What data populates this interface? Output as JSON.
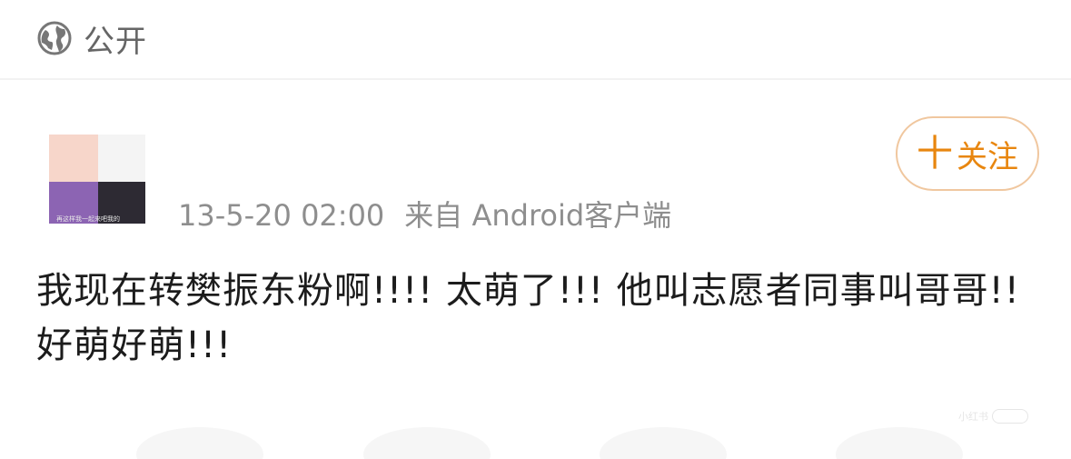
{
  "visibility": {
    "icon": "globe-icon",
    "label": "公开"
  },
  "post": {
    "avatar": {
      "caption": "再这样我一起来吧我的"
    },
    "timestamp": "13-5-20 02:00",
    "source": "来自 Android客户端",
    "follow": {
      "plus": "十",
      "label": "关注",
      "color": "#e8860f"
    },
    "body": "我现在转樊振东粉啊!!!! 太萌了!!! 他叫志愿者同事叫哥哥!! 好萌好萌!!!"
  },
  "watermark": {
    "text": "小红书"
  }
}
